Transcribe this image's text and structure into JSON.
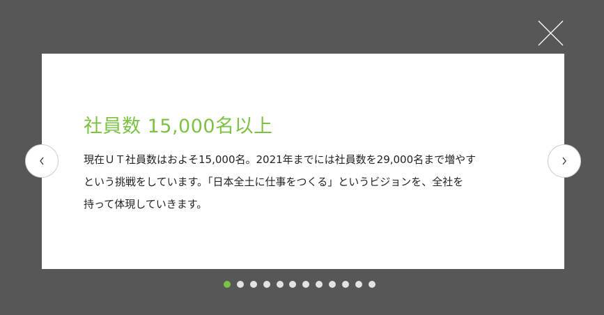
{
  "modal": {
    "title": "社員数 15,000名以上",
    "body_lines": [
      "現在ＵＴ社員数はおよそ15,000名。2021年までには社員数を29,000名まで増やす",
      "という挑戦をしています。「日本全土に仕事をつくる」というビジョンを、全社を",
      "持って体現していきます。"
    ]
  },
  "pagination": {
    "total": 12,
    "current": 1
  },
  "colors": {
    "accent": "#7cc242",
    "overlay": "#575757"
  }
}
